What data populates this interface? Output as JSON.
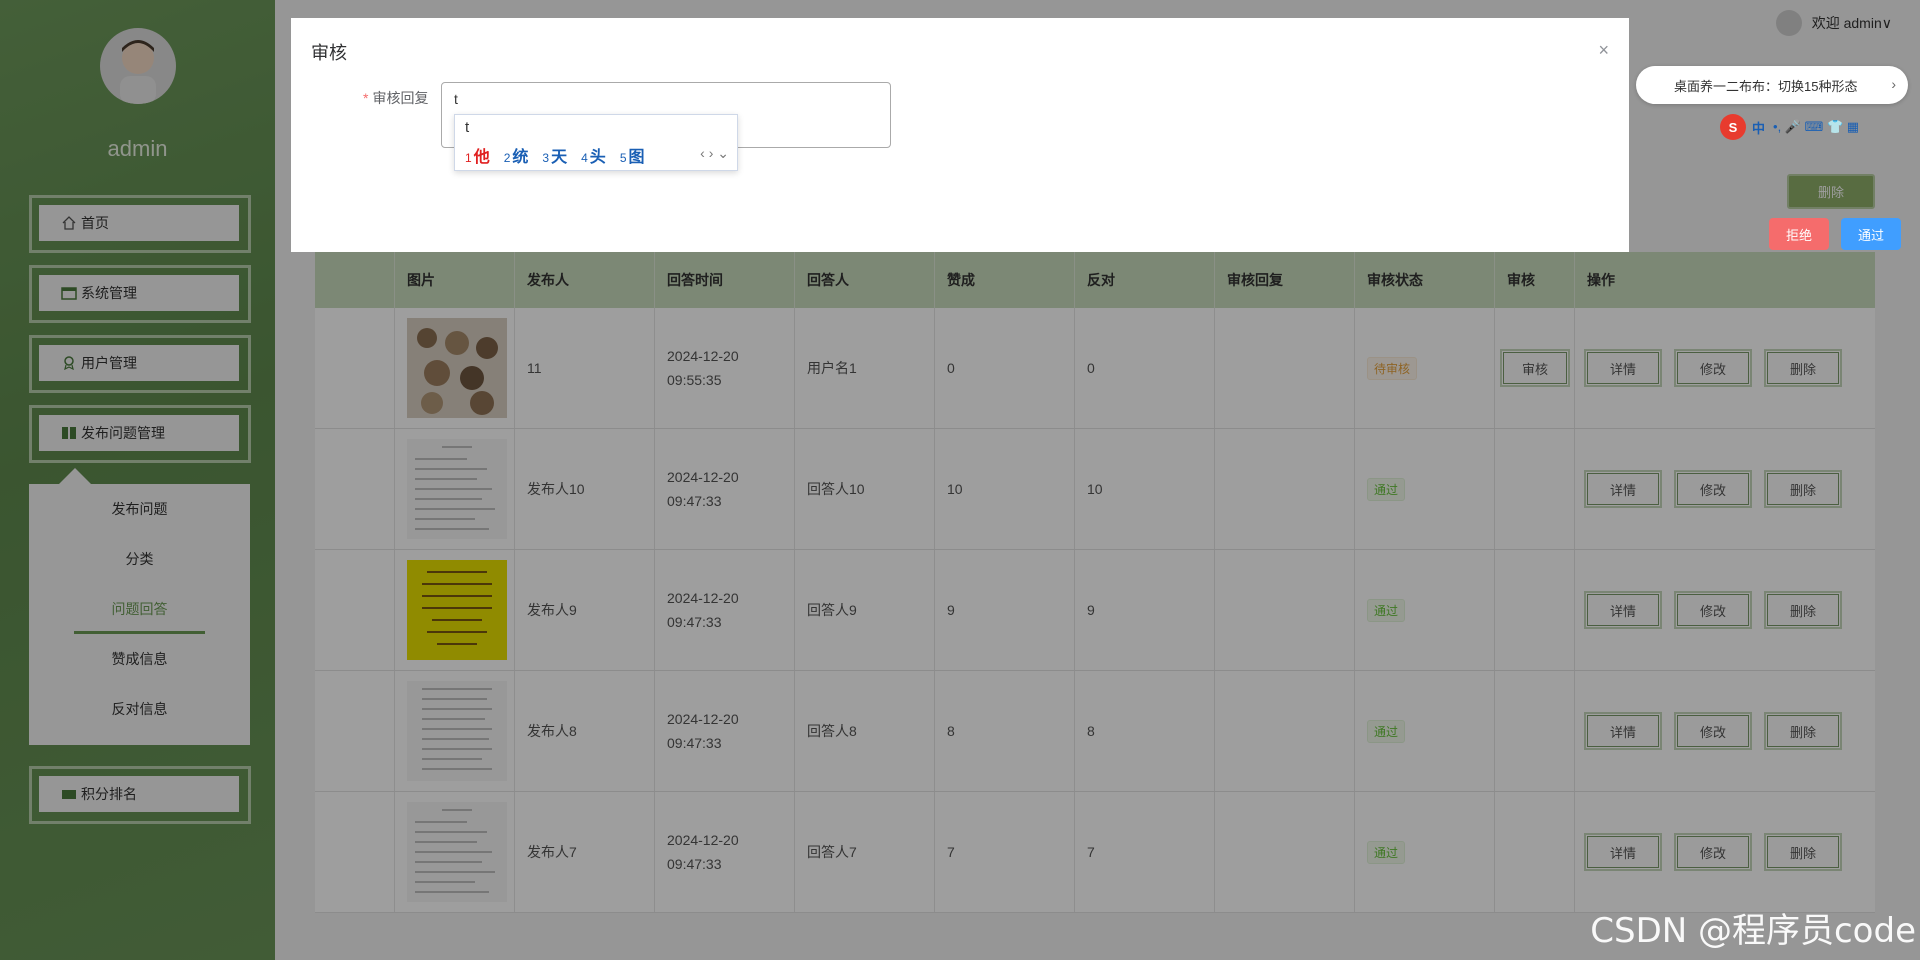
{
  "sidebar": {
    "username": "admin",
    "menu": [
      {
        "label": "首页",
        "icon": "home-icon"
      },
      {
        "label": "系统管理",
        "icon": "table-icon"
      },
      {
        "label": "用户管理",
        "icon": "user-badge-icon"
      },
      {
        "label": "发布问题管理",
        "icon": "book-icon"
      },
      {
        "label": "积分排名",
        "icon": "rank-icon"
      }
    ],
    "submenu": [
      {
        "label": "发布问题"
      },
      {
        "label": "分类"
      },
      {
        "label": "问题回答"
      },
      {
        "label": "赞成信息"
      },
      {
        "label": "反对信息"
      }
    ],
    "active_submenu": "问题回答"
  },
  "header": {
    "welcome": "欢迎 admin",
    "dropdown": "∨"
  },
  "toolbar": {
    "delete_label": "删除"
  },
  "table": {
    "columns": [
      "图片",
      "发布人",
      "回答时间",
      "回答人",
      "赞成",
      "反对",
      "审核回复",
      "审核状态",
      "审核",
      "操作"
    ],
    "rows": [
      {
        "publisher": "11",
        "time": "2024-12-20 09:55:35",
        "answerer": "用户名1",
        "agree": "0",
        "oppose": "0",
        "reply": "",
        "status": "待审核",
        "status_type": "pending",
        "has_review": true
      },
      {
        "publisher": "发布人10",
        "time": "2024-12-20 09:47:33",
        "answerer": "回答人10",
        "agree": "10",
        "oppose": "10",
        "reply": "",
        "status": "通过",
        "status_type": "pass",
        "has_review": false
      },
      {
        "publisher": "发布人9",
        "time": "2024-12-20 09:47:33",
        "answerer": "回答人9",
        "agree": "9",
        "oppose": "9",
        "reply": "",
        "status": "通过",
        "status_type": "pass",
        "has_review": false
      },
      {
        "publisher": "发布人8",
        "time": "2024-12-20 09:47:33",
        "answerer": "回答人8",
        "agree": "8",
        "oppose": "8",
        "reply": "",
        "status": "通过",
        "status_type": "pass",
        "has_review": false
      },
      {
        "publisher": "发布人7",
        "time": "2024-12-20 09:47:33",
        "answerer": "回答人7",
        "agree": "7",
        "oppose": "7",
        "reply": "",
        "status": "通过",
        "status_type": "pass",
        "has_review": false
      }
    ],
    "actions": {
      "review": "审核",
      "detail": "详情",
      "edit": "修改",
      "delete": "删除"
    }
  },
  "dialog": {
    "title": "审核",
    "field_label": "审核回复",
    "required_mark": "*",
    "field_value": "t",
    "close": "×",
    "reject_label": "拒绝",
    "pass_label": "通过"
  },
  "ime": {
    "input": "t",
    "candidates": [
      {
        "num": "1",
        "text": "他"
      },
      {
        "num": "2",
        "text": "统"
      },
      {
        "num": "3",
        "text": "天"
      },
      {
        "num": "4",
        "text": "头"
      },
      {
        "num": "5",
        "text": "图"
      }
    ],
    "nav": "‹ › ⌄"
  },
  "notification": {
    "text": "桌面养一二布布：切换15种形态",
    "arrow": "›"
  },
  "ime_toolbar": {
    "logo": "S",
    "mode": "中",
    "items": "•, 🎤 ⌨ 👕 ▦"
  },
  "watermark": "CSDN @程序员code"
}
